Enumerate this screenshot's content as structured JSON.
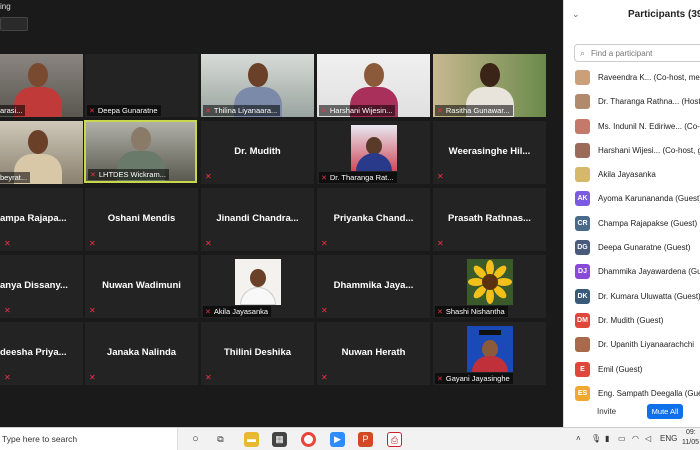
{
  "meeting": {
    "window_title": "ing",
    "view_button": ""
  },
  "tiles": [
    {
      "name": "a Amarasi..."
    },
    {
      "name": "Deepa Gunaratne"
    },
    {
      "name": "Thilina Liyanaara..."
    },
    {
      "name": "Harshani Wijesin..."
    },
    {
      "name": "Rasitha Gunawar..."
    },
    {
      "name": "tha Abeyrat..."
    },
    {
      "name": "LHTDES Wickram..."
    },
    {
      "name": "Dr. Mudith"
    },
    {
      "name": "Dr. Tharanga Rat..."
    },
    {
      "name": "Weerasinghe Hil..."
    },
    {
      "name": "ampa Rajapa..."
    },
    {
      "name": "Oshani Mendis"
    },
    {
      "name": "Jinandi Chandra..."
    },
    {
      "name": "Priyanka Chand..."
    },
    {
      "name": "Prasath Rathnas..."
    },
    {
      "name": "anya Dissany..."
    },
    {
      "name": "Nuwan Wadimuni"
    },
    {
      "name": "Akila Jayasanka"
    },
    {
      "name": "Dhammika Jaya..."
    },
    {
      "name": "Shashi Nishantha"
    },
    {
      "name": "deesha Priya..."
    },
    {
      "name": "Janaka Nalinda"
    },
    {
      "name": "Thilini Deshika"
    },
    {
      "name": "Nuwan Herath"
    },
    {
      "name": "Gayani Jayasinghe"
    }
  ],
  "panel": {
    "title": "Participants (39)",
    "search_placeholder": "Find a participant",
    "invite_label": "Invite",
    "mute_all_label": "Mute All",
    "participants": [
      {
        "initials": "",
        "name": "Raveendra K...  (Co-host, me)",
        "color": "#c9a07a"
      },
      {
        "initials": "",
        "name": "Dr. Tharanga Rathna...  (Host)",
        "color": "#b08a6a"
      },
      {
        "initials": "",
        "name": "Ms. Indunil N. Ediriwe...  (Co-ho",
        "color": "#c47a6a"
      },
      {
        "initials": "",
        "name": "Harshani Wijesi...  (Co-host, gu",
        "color": "#9a6a5a"
      },
      {
        "initials": "",
        "name": "Akila Jayasanka",
        "color": "#d6b86a"
      },
      {
        "initials": "AK",
        "name": "Ayoma Karunananda  (Guest)",
        "color": "#7b5ce0"
      },
      {
        "initials": "CR",
        "name": "Champa Rajapakse  (Guest)",
        "color": "#4a6a8a"
      },
      {
        "initials": "DG",
        "name": "Deepa Gunaratne  (Guest)",
        "color": "#4a5a7a"
      },
      {
        "initials": "DJ",
        "name": "Dhammika Jayawardena  (Gues",
        "color": "#8a4ad8"
      },
      {
        "initials": "DK",
        "name": "Dr. Kumara Uluwatta  (Guest)",
        "color": "#3a5a7a"
      },
      {
        "initials": "DM",
        "name": "Dr. Mudith   (Guest)",
        "color": "#e0463a"
      },
      {
        "initials": "",
        "name": "Dr. Upanith Liyanaarachchi",
        "color": "#a86a4a"
      },
      {
        "initials": "E",
        "name": "Emil (Guest)",
        "color": "#e0463a"
      },
      {
        "initials": "ES",
        "name": "Eng. Sampath Deegalla  (Guest",
        "color": "#f0a830"
      }
    ]
  },
  "taskbar": {
    "search_text": "Type here to search",
    "language": "ENG",
    "time": "09:",
    "date": "11/05"
  }
}
